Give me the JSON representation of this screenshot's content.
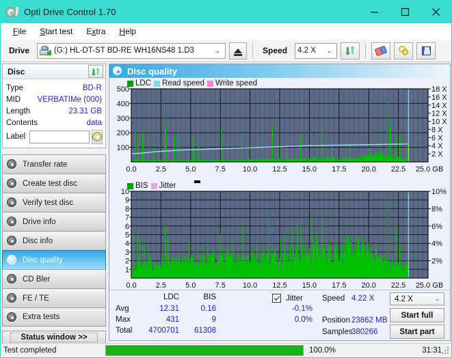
{
  "window": {
    "title": "Opti Drive Control 1.70",
    "icon": "disc-pen-icon",
    "minimize": "–",
    "maximize": "□",
    "close": "✕",
    "titlebar_color": "#3adbd0"
  },
  "menu": [
    {
      "label": "File",
      "accel": "F"
    },
    {
      "label": "Start test",
      "accel": "S"
    },
    {
      "label": "Extra",
      "accel": "x"
    },
    {
      "label": "Help",
      "accel": "H"
    }
  ],
  "toolbar": {
    "drive_label": "Drive",
    "drive_value": "(G:)  HL-DT-ST BD-RE  WH16NS48 1.D3",
    "eject_icon": "eject-icon",
    "speed_label": "Speed",
    "speed_value": "4.2 X",
    "refresh_icon": "refresh-icon",
    "erase_icon": "erase-icon",
    "settings_icon": "gear-icon",
    "save_icon": "save-icon",
    "dropdown_arrow": "⌄"
  },
  "disc_panel": {
    "title": "Disc",
    "refresh_icon": "refresh-icon",
    "rows": [
      {
        "key": "Type",
        "value": "BD-R"
      },
      {
        "key": "MID",
        "value": "VERBATIMe (000)"
      },
      {
        "key": "Length",
        "value": "23.31 GB"
      },
      {
        "key": "Contents",
        "value": "data"
      }
    ],
    "label_key": "Label",
    "label_value": "",
    "label_placeholder": "",
    "label_button_icon": "disc-icon"
  },
  "nav": {
    "items": [
      {
        "label": "Transfer rate",
        "icon": "disc-icon",
        "active": false
      },
      {
        "label": "Create test disc",
        "icon": "disc-icon",
        "active": false
      },
      {
        "label": "Verify test disc",
        "icon": "disc-icon",
        "active": false
      },
      {
        "label": "Drive info",
        "icon": "disc-icon",
        "active": false
      },
      {
        "label": "Disc info",
        "icon": "disc-icon",
        "active": false
      },
      {
        "label": "Disc quality",
        "icon": "disc-icon",
        "active": true
      },
      {
        "label": "CD Bler",
        "icon": "disc-icon",
        "active": false
      },
      {
        "label": "FE / TE",
        "icon": "disc-icon",
        "active": false
      },
      {
        "label": "Extra tests",
        "icon": "disc-icon",
        "active": false
      }
    ],
    "status_window": "Status window >>"
  },
  "main": {
    "title": "Disc quality",
    "icon": "disc-quality-icon"
  },
  "stats": {
    "col_ldc": "LDC",
    "col_bis": "BIS",
    "row_avg": "Avg",
    "row_max": "Max",
    "row_total": "Total",
    "avg_ldc": "12.31",
    "avg_bis": "0.16",
    "max_ldc": "431",
    "max_bis": "9",
    "total_ldc": "4700701",
    "total_bis": "61308",
    "jitter_label": "Jitter",
    "jitter_checked": true,
    "jitter_avg": "-0.1%",
    "jitter_max": "0.0%",
    "speed_label": "Speed",
    "speed_value": "4.22 X",
    "position_label": "Position",
    "position_value": "23862 MB",
    "samples_label": "Samples",
    "samples_value": "380266",
    "speed_select": "4.2 X",
    "speed_select_arrow": "⌄",
    "start_full": "Start full",
    "start_part": "Start part"
  },
  "statusbar": {
    "message": "Test completed",
    "progress_percent": 100.0,
    "progress_text": "100.0%",
    "elapsed": "31:31"
  },
  "chart_data": [
    {
      "type": "line",
      "id": "ldc-chart",
      "title": "",
      "legend": [
        {
          "label": "LDC",
          "color": "#00a000"
        },
        {
          "label": "Read speed",
          "color": "#86d5f2"
        },
        {
          "label": "Write speed",
          "color": "#ff7fe0"
        }
      ],
      "xlabel": "GB",
      "ylabel": "",
      "xlim": [
        0.0,
        25.0
      ],
      "xticks": [
        "0.0",
        "2.5",
        "5.0",
        "7.5",
        "10.0",
        "12.5",
        "15.0",
        "17.5",
        "20.0",
        "22.5",
        "25.0 GB"
      ],
      "ylim": [
        0,
        500
      ],
      "yticks": [
        "100",
        "200",
        "300",
        "400",
        "500"
      ],
      "y2lim": [
        0,
        18
      ],
      "y2ticks": [
        "2 X",
        "4 X",
        "6 X",
        "8 X",
        "10 X",
        "12 X",
        "14 X",
        "16 X",
        "18 X"
      ],
      "grid": true,
      "plot_bg": "#5c6b85",
      "series": [
        {
          "name": "LDC",
          "color": "#00c000",
          "kind": "spike-fill",
          "baseline": [
            8,
            10,
            12,
            11,
            9,
            10,
            12,
            11,
            10,
            9,
            11,
            12,
            10,
            9,
            10,
            11,
            12,
            10,
            9,
            10,
            11,
            10,
            9,
            10,
            11,
            12,
            11,
            10,
            9,
            10,
            11,
            12,
            13,
            12,
            11,
            10,
            12,
            11,
            10,
            12,
            11,
            10,
            11,
            12,
            13,
            12,
            11,
            12,
            11,
            10,
            12,
            13,
            14,
            13,
            12,
            13,
            14,
            15,
            14,
            13,
            14,
            15,
            16,
            15,
            14,
            15,
            16,
            17,
            16,
            15,
            16,
            17,
            18,
            17,
            16,
            17,
            18,
            19,
            18,
            17,
            18,
            19,
            20,
            19,
            18,
            19,
            20,
            21,
            20,
            19,
            20,
            21,
            22,
            21,
            20,
            21,
            22,
            23,
            22,
            21,
            22,
            23,
            24,
            23,
            22,
            23,
            24,
            25,
            24,
            23,
            24,
            25,
            26,
            27,
            28,
            30,
            32,
            34,
            36,
            38,
            40,
            42,
            44,
            46,
            44,
            42,
            40,
            38,
            36,
            34,
            32,
            30,
            28,
            26,
            25,
            24,
            23,
            22,
            21,
            20,
            19,
            18,
            17,
            16,
            15,
            14,
            13,
            12,
            11,
            10
          ],
          "spikes": [
            {
              "x": 0.35,
              "y": 210
            },
            {
              "x": 0.55,
              "y": 125
            },
            {
              "x": 0.95,
              "y": 200
            },
            {
              "x": 1.0,
              "y": 185
            },
            {
              "x": 1.9,
              "y": 95
            },
            {
              "x": 2.85,
              "y": 300
            },
            {
              "x": 2.9,
              "y": 225
            },
            {
              "x": 3.6,
              "y": 175
            },
            {
              "x": 3.9,
              "y": 200
            },
            {
              "x": 4.1,
              "y": 150
            },
            {
              "x": 5.2,
              "y": 170
            },
            {
              "x": 5.3,
              "y": 80
            },
            {
              "x": 5.7,
              "y": 110
            },
            {
              "x": 7.6,
              "y": 230
            },
            {
              "x": 7.7,
              "y": 95
            },
            {
              "x": 9.3,
              "y": 180
            },
            {
              "x": 10.1,
              "y": 90
            },
            {
              "x": 11.9,
              "y": 250
            },
            {
              "x": 12.6,
              "y": 120
            },
            {
              "x": 13.1,
              "y": 110
            },
            {
              "x": 14.2,
              "y": 195
            },
            {
              "x": 16.1,
              "y": 260
            },
            {
              "x": 16.9,
              "y": 140
            },
            {
              "x": 18.4,
              "y": 120
            },
            {
              "x": 20.0,
              "y": 100
            },
            {
              "x": 20.9,
              "y": 195
            },
            {
              "x": 21.6,
              "y": 431
            },
            {
              "x": 21.8,
              "y": 260
            },
            {
              "x": 22.3,
              "y": 180
            },
            {
              "x": 22.6,
              "y": 185
            },
            {
              "x": 23.3,
              "y": 130
            }
          ]
        },
        {
          "name": "Read speed",
          "color": "#9fdcf7",
          "kind": "step-line",
          "points": [
            [
              0.0,
              2.0
            ],
            [
              1.0,
              2.2
            ],
            [
              2.0,
              2.5
            ],
            [
              3.0,
              2.7
            ],
            [
              4.0,
              2.9
            ],
            [
              5.0,
              3.0
            ],
            [
              6.0,
              3.1
            ],
            [
              7.0,
              3.2
            ],
            [
              8.0,
              3.3
            ],
            [
              9.0,
              3.4
            ],
            [
              10.0,
              3.5
            ],
            [
              11.0,
              3.6
            ],
            [
              12.0,
              3.7
            ],
            [
              13.0,
              3.8
            ],
            [
              14.0,
              3.9
            ],
            [
              15.0,
              4.0
            ],
            [
              16.0,
              4.05
            ],
            [
              17.0,
              4.1
            ],
            [
              18.0,
              4.15
            ],
            [
              19.0,
              4.2
            ],
            [
              20.0,
              4.25
            ],
            [
              21.0,
              4.3
            ],
            [
              22.0,
              4.35
            ],
            [
              23.0,
              4.4
            ],
            [
              23.3,
              4.4
            ]
          ]
        }
      ],
      "cursor": {
        "x": 23.35,
        "color": "#7fd4f5"
      }
    },
    {
      "type": "line",
      "id": "bis-chart",
      "title": "",
      "legend": [
        {
          "label": "BIS",
          "color": "#00a000"
        },
        {
          "label": "Jitter",
          "color": "#e0a8e8"
        }
      ],
      "xlabel": "GB",
      "xlim": [
        0.0,
        25.0
      ],
      "xticks": [
        "0.0",
        "2.5",
        "5.0",
        "7.5",
        "10.0",
        "12.5",
        "15.0",
        "17.5",
        "20.0",
        "22.5",
        "25.0 GB"
      ],
      "ylim": [
        0,
        10
      ],
      "yticks": [
        "1",
        "2",
        "3",
        "4",
        "5",
        "6",
        "7",
        "8",
        "9",
        "10"
      ],
      "y2lim": [
        0,
        10
      ],
      "y2ticks": [
        "2%",
        "4%",
        "6%",
        "8%",
        "10%"
      ],
      "grid": true,
      "plot_bg": "#5c6b85",
      "series": [
        {
          "name": "BIS",
          "color": "#00c000",
          "kind": "spike-fill",
          "baseline": [
            1.0,
            1.1,
            1.2,
            1.3,
            1.5,
            1.4,
            1.6,
            1.5,
            1.4,
            1.5,
            1.6,
            1.5,
            1.4,
            1.5,
            1.6,
            1.7,
            1.6,
            1.5,
            1.6,
            1.7,
            1.6,
            1.5,
            1.6,
            1.7,
            1.8,
            1.7,
            1.6,
            1.7,
            1.8,
            1.7,
            1.8,
            1.9,
            1.8,
            1.7,
            1.8,
            1.9,
            2.0,
            1.9,
            1.8,
            1.9,
            2.0,
            2.1,
            2.0,
            1.9,
            2.0,
            2.1,
            2.0,
            2.1,
            2.2,
            2.1,
            2.0,
            2.1,
            2.2,
            2.1,
            2.2,
            2.3,
            2.2,
            2.1,
            2.2,
            2.3,
            2.2,
            2.3,
            2.4,
            2.3,
            2.2,
            2.3,
            2.4,
            2.3,
            2.4,
            2.5,
            2.4,
            2.3,
            2.4,
            2.5,
            2.4,
            2.5,
            2.6,
            2.5,
            2.4,
            2.5,
            2.6,
            2.5,
            2.6,
            2.7,
            2.6,
            2.5,
            2.6,
            2.7,
            2.8,
            2.7,
            2.6,
            2.7,
            2.8,
            2.9,
            2.8,
            2.7,
            2.8,
            2.9,
            3.0,
            2.9,
            2.8,
            2.9,
            3.0,
            3.1,
            3.0,
            2.9,
            3.0,
            3.1,
            3.2,
            3.1,
            3.0,
            3.1,
            3.2,
            3.3,
            3.2,
            3.1,
            3.0,
            2.9,
            2.8,
            2.7,
            2.6,
            2.5,
            2.4,
            2.3,
            2.2,
            2.1,
            2.0,
            1.9,
            1.8,
            1.7,
            1.6,
            1.5,
            1.5,
            1.4,
            1.4,
            1.3,
            1.3,
            1.2,
            1.2,
            1.2,
            1.2,
            1.2,
            1.2,
            1.2,
            1.2,
            1.2,
            1.2,
            1.2,
            1.2,
            1.2
          ],
          "spikes": [
            {
              "x": 0.2,
              "y": 5
            },
            {
              "x": 0.5,
              "y": 5
            },
            {
              "x": 0.75,
              "y": 4.5
            },
            {
              "x": 1.1,
              "y": 4
            },
            {
              "x": 1.5,
              "y": 3
            },
            {
              "x": 2.6,
              "y": 3
            },
            {
              "x": 2.9,
              "y": 6
            },
            {
              "x": 3.1,
              "y": 4.5
            },
            {
              "x": 4.9,
              "y": 4
            },
            {
              "x": 5.6,
              "y": 4
            },
            {
              "x": 6.4,
              "y": 4
            },
            {
              "x": 7.5,
              "y": 5
            },
            {
              "x": 8.6,
              "y": 4
            },
            {
              "x": 9.4,
              "y": 6
            },
            {
              "x": 10.6,
              "y": 4
            },
            {
              "x": 11.6,
              "y": 7
            },
            {
              "x": 12.6,
              "y": 4.5
            },
            {
              "x": 12.9,
              "y": 5
            },
            {
              "x": 13.6,
              "y": 6
            },
            {
              "x": 14.0,
              "y": 6.5
            },
            {
              "x": 14.3,
              "y": 6
            },
            {
              "x": 15.2,
              "y": 7
            },
            {
              "x": 15.6,
              "y": 5
            },
            {
              "x": 16.1,
              "y": 7
            },
            {
              "x": 17.2,
              "y": 4
            },
            {
              "x": 18.2,
              "y": 4
            },
            {
              "x": 19.6,
              "y": 4
            },
            {
              "x": 20.6,
              "y": 4
            },
            {
              "x": 21.6,
              "y": 9
            },
            {
              "x": 22.3,
              "y": 6
            },
            {
              "x": 22.6,
              "y": 4
            },
            {
              "x": 23.2,
              "y": 2
            }
          ]
        }
      ],
      "cursor": {
        "x": 23.35,
        "color": "#7fd4f5"
      }
    }
  ]
}
